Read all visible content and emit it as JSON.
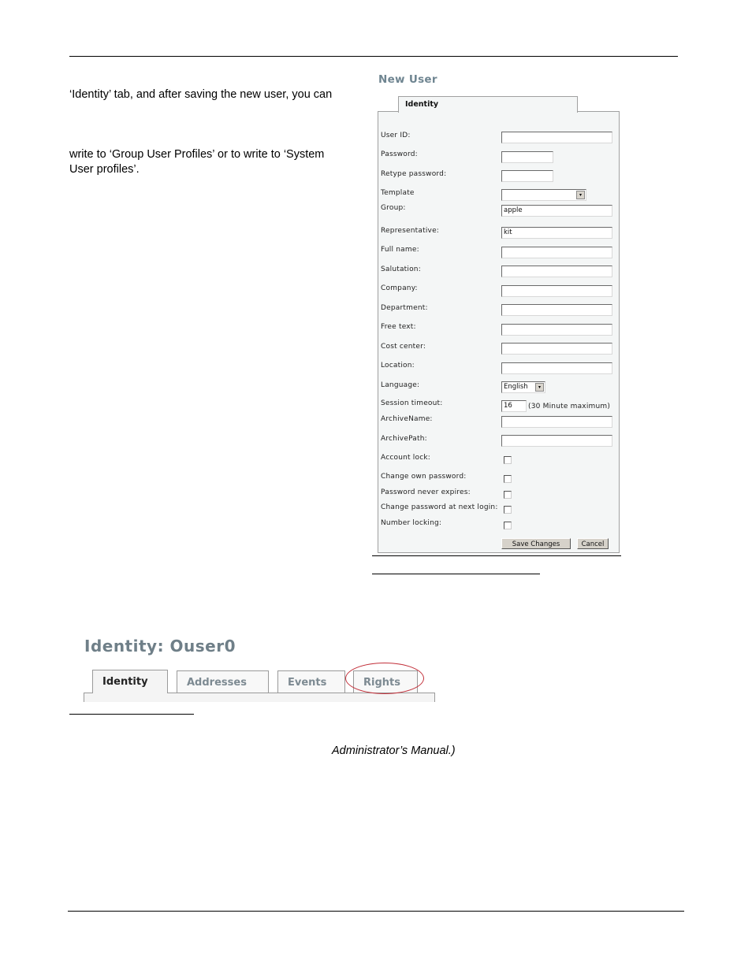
{
  "document": {
    "paragraph_1": "‘Identity’ tab, and after saving the new user, you can",
    "paragraph_2_line_1": "write to ‘Group User Profiles’ or to write to ‘System",
    "paragraph_2_line_2": "User profiles’.",
    "reference_text": "Administrator’s Manual.)"
  },
  "new_user_form": {
    "title": "New User",
    "tab_label": "Identity",
    "fields": [
      {
        "label": "User ID:",
        "value": ""
      },
      {
        "label": "Password:",
        "value": ""
      },
      {
        "label": "Retype password:",
        "value": ""
      },
      {
        "label": "Template",
        "value": ""
      },
      {
        "label": "Group:",
        "value": "apple"
      },
      {
        "label": "Representative:",
        "value": "kit"
      },
      {
        "label": "Full name:",
        "value": ""
      },
      {
        "label": "Salutation:",
        "value": ""
      },
      {
        "label": "Company:",
        "value": ""
      },
      {
        "label": "Department:",
        "value": ""
      },
      {
        "label": "Free text:",
        "value": ""
      },
      {
        "label": "Cost center:",
        "value": ""
      },
      {
        "label": "Location:",
        "value": ""
      },
      {
        "label": "Language:",
        "value": "English"
      },
      {
        "label": "Session timeout:",
        "value": "16"
      },
      {
        "label": "ArchiveName:",
        "value": ""
      },
      {
        "label": "ArchivePath:",
        "value": ""
      }
    ],
    "session_timeout_note": "(30 Minute maximum)",
    "checkboxes": [
      {
        "label": "Account lock:",
        "checked": false
      },
      {
        "label": "Change own password:",
        "checked": false
      },
      {
        "label": "Password never expires:",
        "checked": false
      },
      {
        "label": "Change password at next login:",
        "checked": false
      },
      {
        "label": "Number locking:",
        "checked": false
      }
    ],
    "save_label": "Save Changes",
    "cancel_label": "Cancel"
  },
  "identity_view": {
    "title": "Identity: Ouser0",
    "tabs": [
      {
        "label": "Identity",
        "active": true
      },
      {
        "label": "Addresses",
        "active": false
      },
      {
        "label": "Events",
        "active": false
      },
      {
        "label": "Rights",
        "active": false,
        "highlighted": true
      }
    ],
    "highlight_color": "#c2303a"
  },
  "icons": {
    "dropdown_arrow": "▾"
  }
}
